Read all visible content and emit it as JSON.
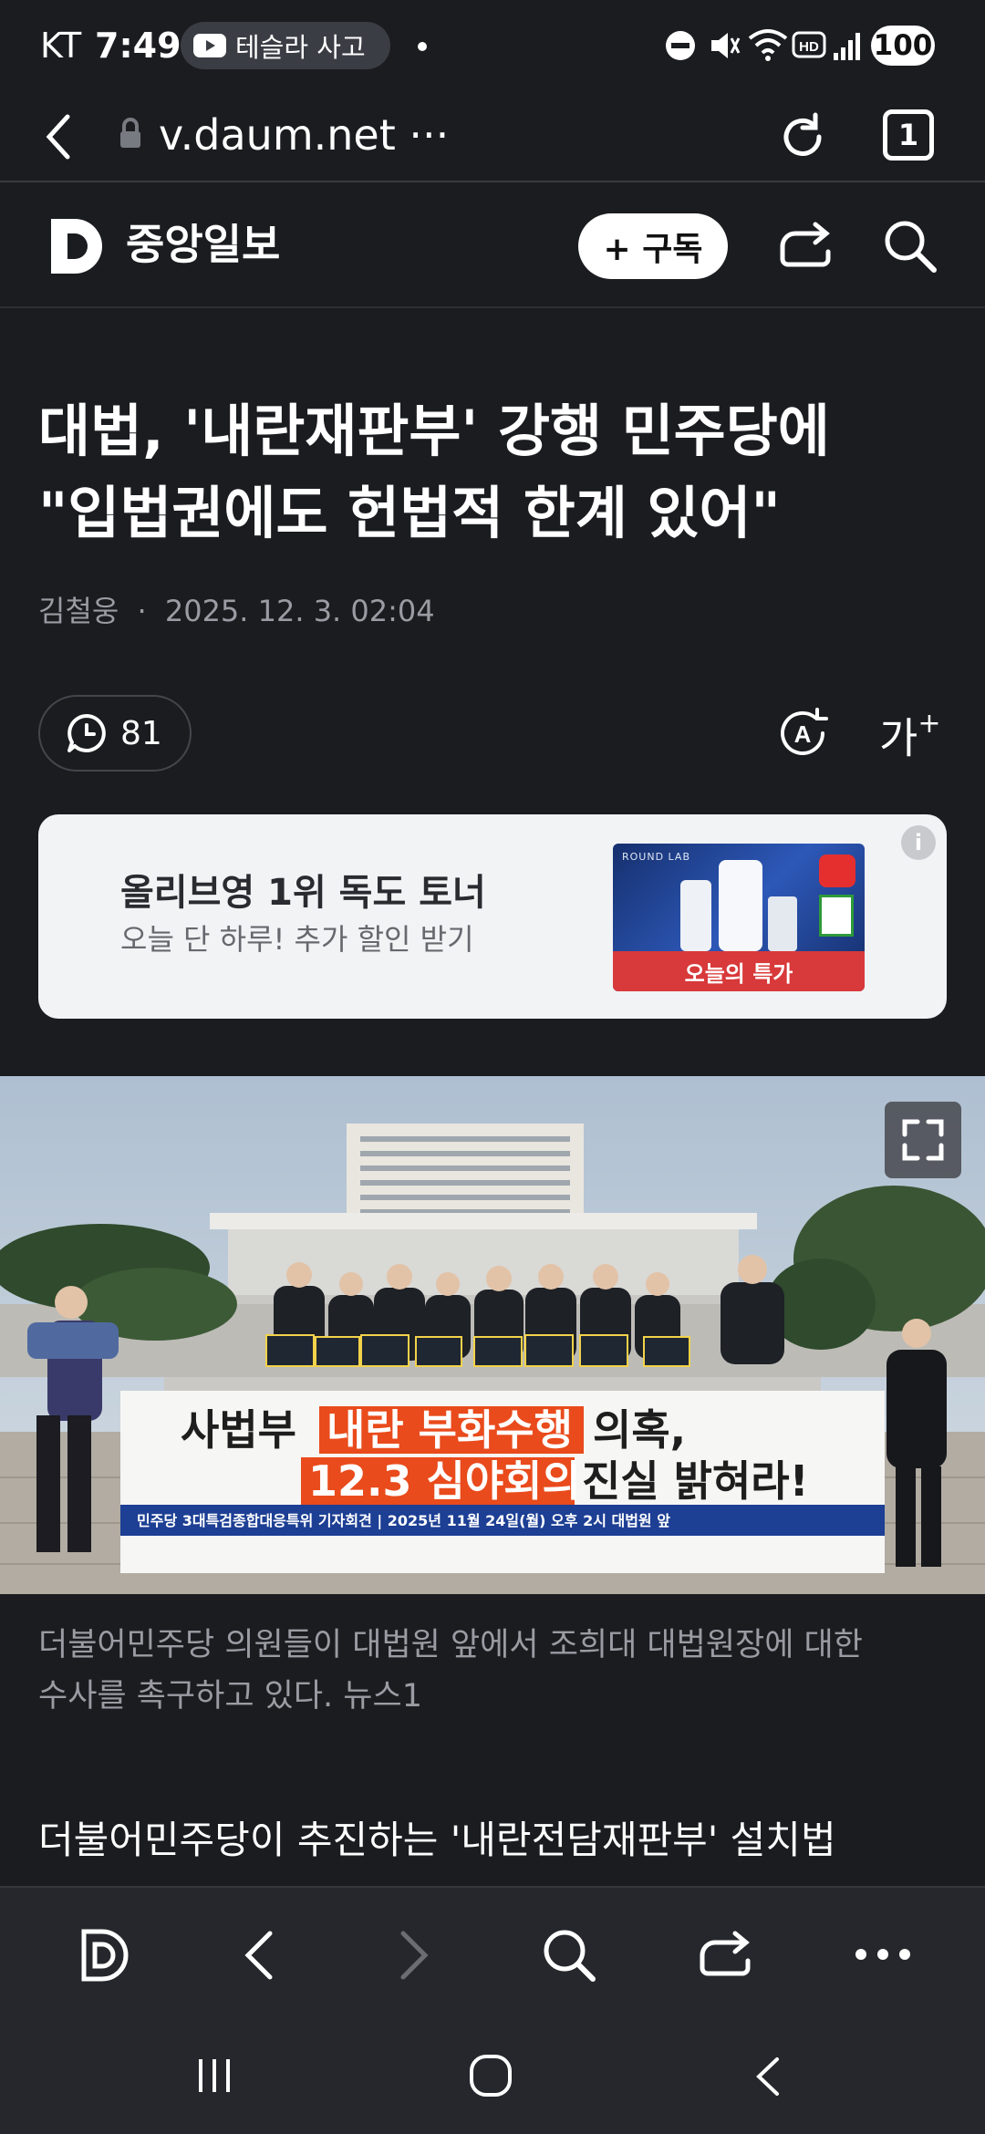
{
  "status_bar": {
    "carrier": "KT",
    "time": "7:49",
    "notification_text": "테슬라 사고",
    "battery": "100"
  },
  "browser": {
    "url": "v.daum.net ···",
    "tab_count": "1"
  },
  "site_header": {
    "press_name": "중앙일보",
    "subscribe_label": "+ 구독"
  },
  "article": {
    "headline_line1": "대법, '내란재판부' 강행 민주당에",
    "headline_line2": "\"입법권에도 헌법적 한계 있어\"",
    "author": "김철웅",
    "date": "2025. 12. 3. 02:04",
    "comment_count": "81",
    "font_size_label": "가",
    "caption_line1": "더불어민주당 의원들이 대법원 앞에서 조희대 대법원장에 대한",
    "caption_line2": "수사를 촉구하고 있다. 뉴스1",
    "body_first_line": "더불어민주당이 추진하는 '내란전담재판부' 설치법"
  },
  "ad": {
    "title": "올리브영 1위 독도 토너",
    "subtitle": "오늘 단 하루! 추가 할인 받기",
    "image_band": "오늘의 특가",
    "image_brand": "ROUND LAB",
    "info": "i"
  },
  "photo": {
    "banner_line1_a": "사법부",
    "banner_line1_b": "내란 부화수행",
    "banner_line1_c": "의혹,",
    "banner_line2_a": "12.3 심야회의",
    "banner_line2_b": "진실 밝혀라!",
    "banner_footer": "민주당 3대특검종합대응특위 기자회견  |  2025년 11월 24일(월) 오후 2시 대법원 앞"
  },
  "colors": {
    "background": "#1b1c20",
    "toolbar": "#26272c",
    "banner_red": "#c8231e",
    "banner_orange": "#e94b1c",
    "banner_blue": "#1d3f94"
  }
}
